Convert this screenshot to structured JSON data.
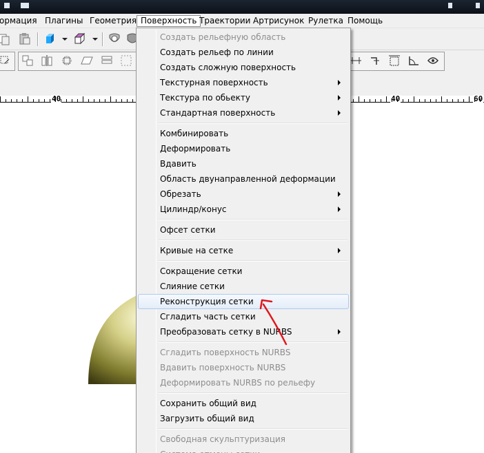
{
  "menubar": {
    "items": [
      "ормация",
      "Плагины",
      "Геометрия",
      "Поверхность",
      "Траектории",
      "Артрисунок",
      "Рулетка",
      "Помощь"
    ],
    "open_item": "Поверхность"
  },
  "ruler": {
    "labels": [
      "40",
      "40",
      "60"
    ]
  },
  "dropdown": {
    "group1": [
      {
        "label": "Создать рельефную область",
        "disabled": true
      },
      {
        "label": "Создать рельеф по линии"
      },
      {
        "label": "Создать сложную поверхность"
      },
      {
        "label": "Текстурная поверхность",
        "submenu": true
      },
      {
        "label": "Текстура по обьекту",
        "submenu": true
      },
      {
        "label": "Стандартная поверхность",
        "submenu": true
      }
    ],
    "group2": [
      {
        "label": "Комбинировать"
      },
      {
        "label": "Деформировать"
      },
      {
        "label": "Вдавить"
      },
      {
        "label": "Область двунаправленной деформации"
      },
      {
        "label": "Обрезать",
        "submenu": true
      },
      {
        "label": "Цилиндр/конус",
        "submenu": true
      }
    ],
    "group3": [
      {
        "label": "Офсет сетки"
      }
    ],
    "group4": [
      {
        "label": "Кривые на сетке",
        "submenu": true
      }
    ],
    "group5": [
      {
        "label": "Сокращение сетки"
      },
      {
        "label": "Слияние сетки"
      },
      {
        "label": "Реконструкция сетки",
        "highlighted": true
      },
      {
        "label": "Сгладить часть сетки"
      },
      {
        "label": "Преобразовать сетку в NURBS",
        "submenu": true
      }
    ],
    "group6": [
      {
        "label": "Сгладить поверхность NURBS",
        "disabled": true
      },
      {
        "label": "Вдавить поверхность NURBS",
        "disabled": true
      },
      {
        "label": "Деформировать NURBS по рельефу",
        "disabled": true
      }
    ],
    "group7": [
      {
        "label": "Сохранить общий вид"
      },
      {
        "label": "Загрузить общий вид"
      }
    ],
    "group8": [
      {
        "label": "Свободная скульптуризация",
        "disabled": true
      },
      {
        "label": "Система отмены сетки",
        "disabled": true
      }
    ]
  },
  "colors": {
    "highlight_border": "#aecaf0",
    "annotation": "#e0161c",
    "dome": "#d8d48c"
  },
  "icons": [
    "copy-icon",
    "paste-icon",
    "cube-blue-icon",
    "cube-outline-icon",
    "shield-icon",
    "align-icon",
    "transform-icon"
  ]
}
